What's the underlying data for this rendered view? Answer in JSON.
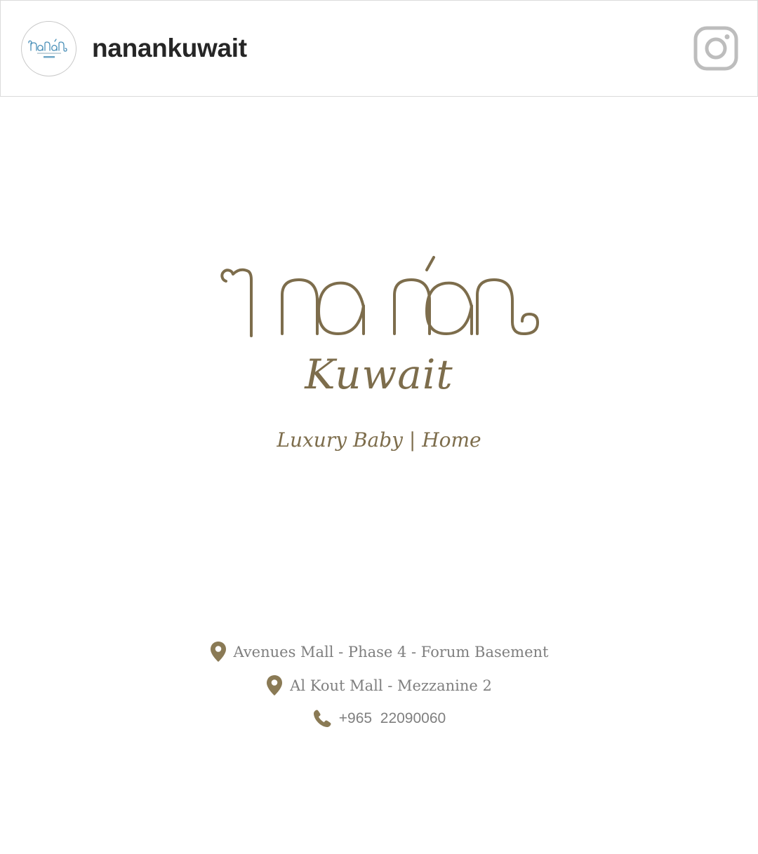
{
  "header": {
    "username": "nanankuwait",
    "avatar_icon": "nanan-logo-avatar",
    "platform_icon": "instagram-icon"
  },
  "post": {
    "brand_name": "Nanan",
    "brand_location": "Kuwait",
    "tagline": "Luxury Baby | Home",
    "locations": [
      {
        "icon": "map-pin-icon",
        "text": "Avenues Mall - Phase 4 - Forum Basement"
      },
      {
        "icon": "map-pin-icon",
        "text": "Al Kout Mall - Mezzanine 2"
      }
    ],
    "phone": {
      "icon": "phone-icon",
      "text": "+965  22090060"
    }
  },
  "colors": {
    "brand_gold": "#7d6d4c",
    "pin_gold": "#8a7a55",
    "text_gray": "#7f7f7f",
    "username": "#262626",
    "avatar_logo_blue": "#4a90b8"
  }
}
